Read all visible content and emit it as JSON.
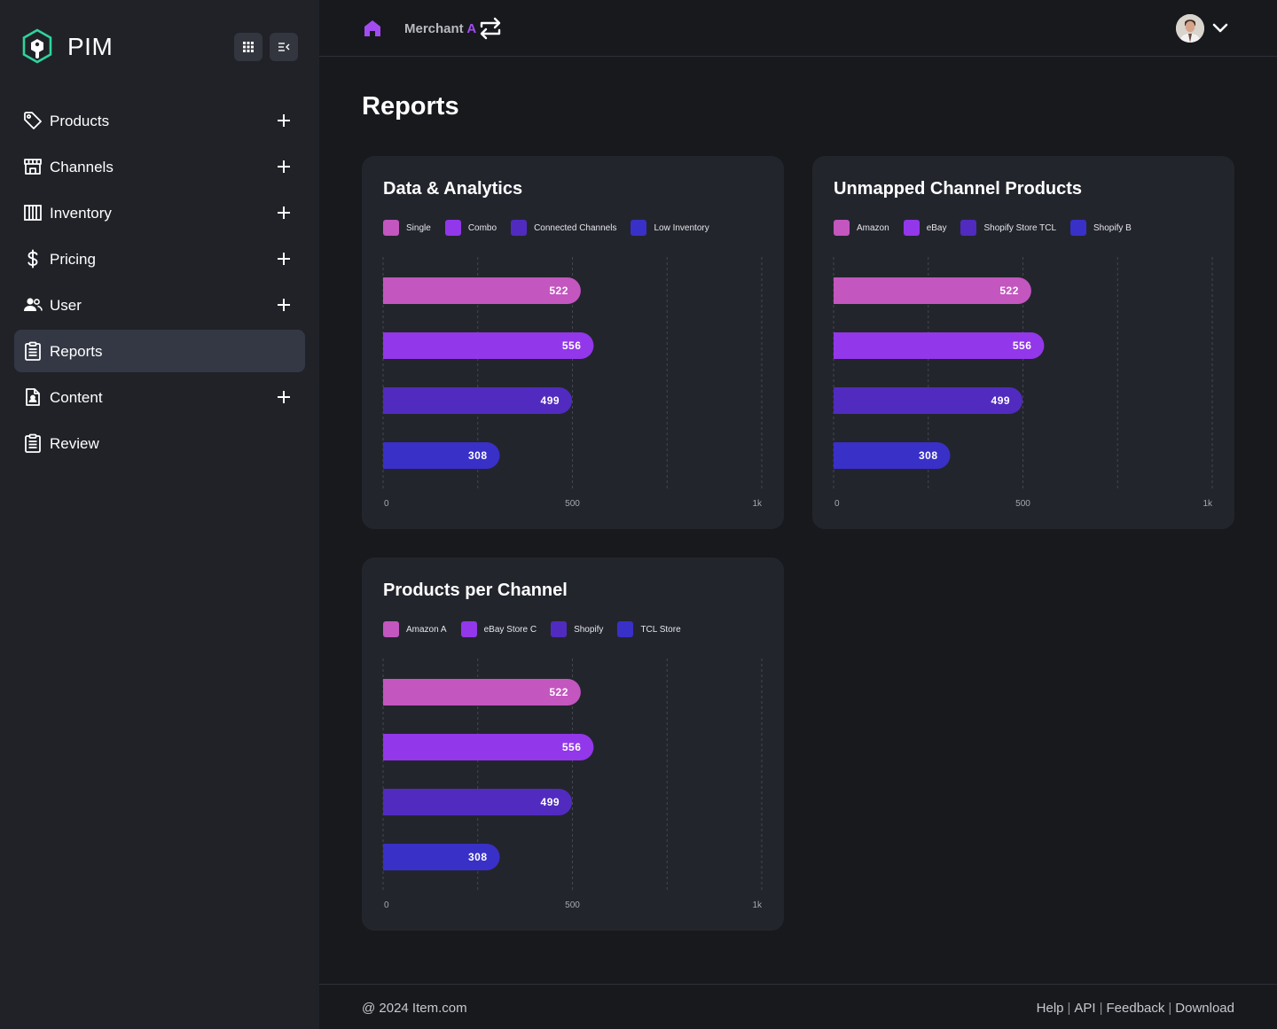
{
  "app": {
    "logo_text": "PIM"
  },
  "sidebar": {
    "items": [
      {
        "label": "Products",
        "icon": "tag-icon",
        "expandable": true
      },
      {
        "label": "Channels",
        "icon": "store-icon",
        "expandable": true
      },
      {
        "label": "Inventory",
        "icon": "warehouse-icon",
        "expandable": true
      },
      {
        "label": "Pricing",
        "icon": "dollar-icon",
        "expandable": true
      },
      {
        "label": "User",
        "icon": "users-icon",
        "expandable": true
      },
      {
        "label": "Reports",
        "icon": "clipboard-icon",
        "expandable": false,
        "active": true
      },
      {
        "label": "Content",
        "icon": "document-user-icon",
        "expandable": true
      },
      {
        "label": "Review",
        "icon": "clipboard-list-icon",
        "expandable": false
      }
    ]
  },
  "topbar": {
    "merchant_label": "Merchant",
    "merchant_suffix": "A"
  },
  "page": {
    "title": "Reports"
  },
  "colors": {
    "accent": "#a24cf0",
    "series": [
      "#c356bf",
      "#9237ea",
      "#512bbf",
      "#3930c8"
    ]
  },
  "chart_data": [
    {
      "type": "bar",
      "title": "Data & Analytics",
      "series": [
        {
          "name": "Single",
          "value": 522
        },
        {
          "name": "Combo",
          "value": 556
        },
        {
          "name": "Connected Channels",
          "value": 499
        },
        {
          "name": "Low Inventory",
          "value": 308
        }
      ],
      "xlim": [
        0,
        1000
      ],
      "x_ticks": [
        "0",
        "500",
        "1k"
      ],
      "orientation": "horizontal",
      "legend": "top-left",
      "grid": true
    },
    {
      "type": "bar",
      "title": "Unmapped Channel Products",
      "series": [
        {
          "name": "Amazon",
          "value": 522
        },
        {
          "name": "eBay",
          "value": 556
        },
        {
          "name": "Shopify Store TCL",
          "value": 499
        },
        {
          "name": "Shopify B",
          "value": 308
        }
      ],
      "xlim": [
        0,
        1000
      ],
      "x_ticks": [
        "0",
        "500",
        "1k"
      ],
      "orientation": "horizontal",
      "legend": "top-left",
      "grid": true
    },
    {
      "type": "bar",
      "title": "Products per Channel",
      "series": [
        {
          "name": "Amazon A",
          "value": 522
        },
        {
          "name": "eBay Store C",
          "value": 556
        },
        {
          "name": "Shopify",
          "value": 499
        },
        {
          "name": "TCL Store",
          "value": 308
        }
      ],
      "xlim": [
        0,
        1000
      ],
      "x_ticks": [
        "0",
        "500",
        "1k"
      ],
      "orientation": "horizontal",
      "legend": "top-left",
      "grid": true
    }
  ],
  "footer": {
    "copyright": "@ 2024 Item.com",
    "links": [
      "Help",
      "API",
      "Feedback",
      "Download"
    ]
  }
}
